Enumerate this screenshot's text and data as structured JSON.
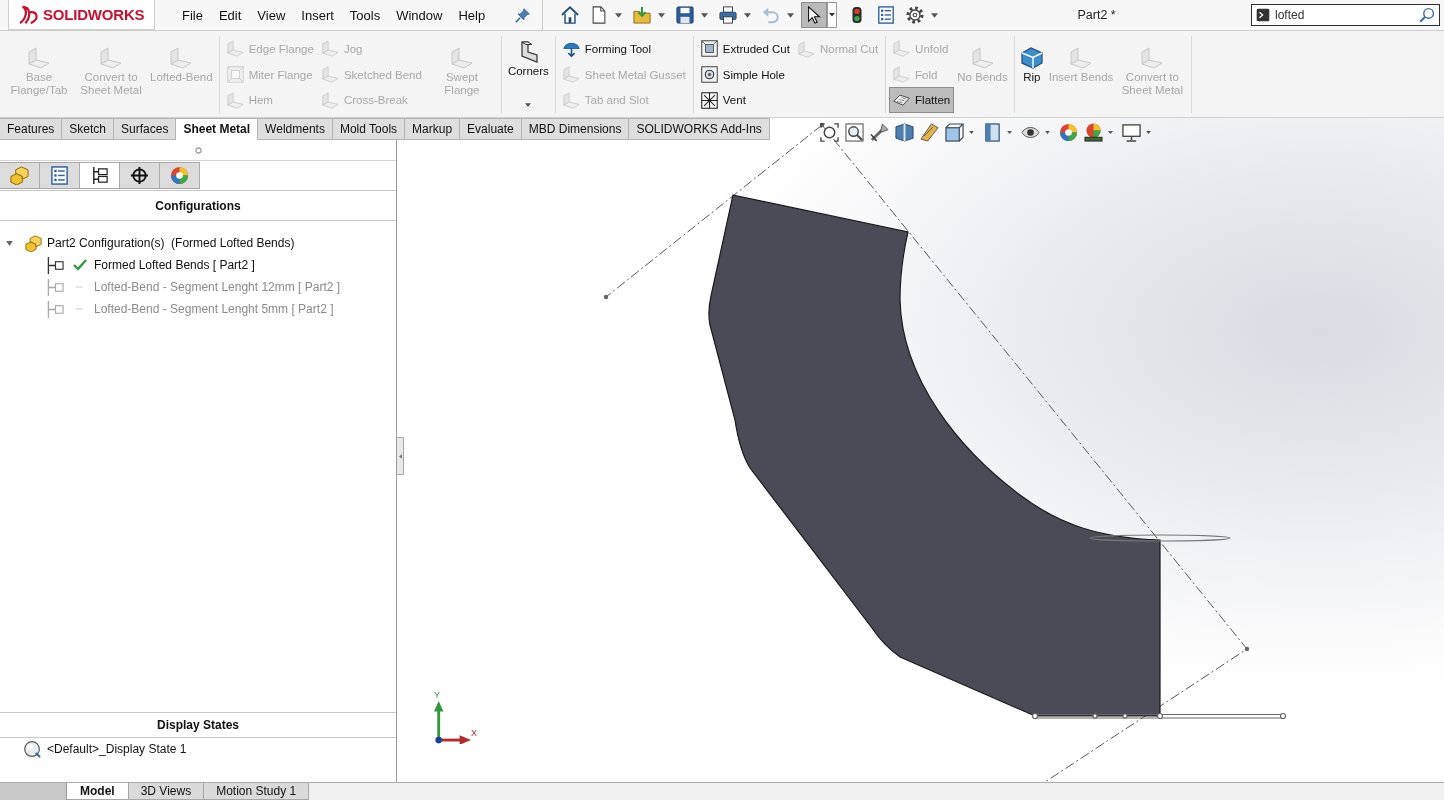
{
  "app": {
    "logo": "SOLIDWORKS"
  },
  "menu": [
    "File",
    "Edit",
    "View",
    "Insert",
    "Tools",
    "Window",
    "Help"
  ],
  "quick_access": [
    {
      "dropdown": false,
      "disabled": false,
      "pressed": false
    },
    {
      "dropdown": true,
      "disabled": false,
      "pressed": false
    },
    {
      "dropdown": true,
      "disabled": false,
      "pressed": false
    },
    {
      "dropdown": true,
      "disabled": false,
      "pressed": false
    },
    {
      "dropdown": true,
      "disabled": false,
      "pressed": false
    },
    {
      "dropdown": true,
      "disabled": true,
      "pressed": false
    },
    {
      "dropdown": true,
      "disabled": false,
      "pressed": true
    },
    {
      "dropdown": false,
      "disabled": false,
      "pressed": false
    },
    {
      "dropdown": false,
      "disabled": false,
      "pressed": false
    },
    {
      "dropdown": true,
      "disabled": false,
      "pressed": false
    }
  ],
  "window": {
    "title": "Part2 *"
  },
  "search": {
    "value": "lofted"
  },
  "ribbon": [
    [
      {
        "kind": "large",
        "label": "Base Flange/Tab",
        "disabled": true,
        "pressed": false
      },
      {
        "kind": "large",
        "label": "Convert to Sheet Metal",
        "disabled": true,
        "pressed": false
      },
      {
        "kind": "large",
        "label": "Lofted-Bend",
        "disabled": true,
        "pressed": false
      }
    ],
    [
      {
        "kind": "stack",
        "items": [
          {
            "label": "Edge Flange",
            "disabled": true,
            "pressed": false
          },
          {
            "label": "Miter Flange",
            "disabled": true,
            "pressed": false
          },
          {
            "label": "Hem",
            "disabled": true,
            "pressed": false
          }
        ]
      },
      {
        "kind": "stack",
        "items": [
          {
            "label": "Jog",
            "disabled": true,
            "pressed": false
          },
          {
            "label": "Sketched Bend",
            "disabled": true,
            "pressed": false
          },
          {
            "label": "Cross-Break",
            "disabled": true,
            "pressed": false
          }
        ]
      },
      {
        "kind": "large",
        "label": "Swept Flange",
        "disabled": true,
        "pressed": false
      }
    ],
    [
      {
        "kind": "dropdown",
        "label": "Corners",
        "disabled": false,
        "pressed": false
      }
    ],
    [
      {
        "kind": "stack",
        "items": [
          {
            "label": "Forming Tool",
            "disabled": false,
            "pressed": false
          },
          {
            "label": "Sheet Metal Gusset",
            "disabled": true,
            "pressed": false
          },
          {
            "label": "Tab and Slot",
            "disabled": true,
            "pressed": false
          }
        ]
      }
    ],
    [
      {
        "kind": "stack",
        "items": [
          {
            "label": "Extruded Cut",
            "disabled": false,
            "pressed": false
          },
          {
            "label": "Simple Hole",
            "disabled": false,
            "pressed": false
          },
          {
            "label": "Vent",
            "disabled": false,
            "pressed": false
          }
        ]
      },
      {
        "kind": "stack",
        "items": [
          {
            "label": "Normal Cut",
            "disabled": true,
            "pressed": false
          }
        ]
      }
    ],
    [
      {
        "kind": "stack",
        "items": [
          {
            "label": "Unfold",
            "disabled": true,
            "pressed": false
          },
          {
            "label": "Fold",
            "disabled": true,
            "pressed": false
          },
          {
            "label": "Flatten",
            "disabled": false,
            "pressed": true
          }
        ]
      },
      {
        "kind": "large",
        "label": "No Bends",
        "disabled": true,
        "pressed": false
      }
    ],
    [
      {
        "kind": "large",
        "label": "Rip",
        "disabled": false,
        "pressed": false
      },
      {
        "kind": "large",
        "label": "Insert Bends",
        "disabled": true,
        "pressed": false
      },
      {
        "kind": "large",
        "label": "Convert to Sheet Metal",
        "disabled": true,
        "pressed": false
      }
    ]
  ],
  "command_tabs": [
    {
      "label": "Features",
      "selected": false
    },
    {
      "label": "Sketch",
      "selected": false
    },
    {
      "label": "Surfaces",
      "selected": false
    },
    {
      "label": "Sheet Metal",
      "selected": true
    },
    {
      "label": "Weldments",
      "selected": false
    },
    {
      "label": "Mold Tools",
      "selected": false
    },
    {
      "label": "Markup",
      "selected": false
    },
    {
      "label": "Evaluate",
      "selected": false
    },
    {
      "label": "MBD Dimensions",
      "selected": false
    },
    {
      "label": "SOLIDWORKS Add-Ins",
      "selected": false
    }
  ],
  "panel_tabs": [
    {
      "selected": false
    },
    {
      "selected": false
    },
    {
      "selected": true
    },
    {
      "selected": false
    },
    {
      "selected": false
    }
  ],
  "configurations": {
    "title": "Configurations",
    "tree": [
      {
        "label": "Part2 Configuration(s)  (Formed Lofted Bends)",
        "expanded": true,
        "children": [
          {
            "label": "Formed Lofted Bends [ Part2 ]",
            "active": true
          },
          {
            "label": "Lofted-Bend - Segment Lenght 12mm [ Part2 ]",
            "active": false
          },
          {
            "label": "Lofted-Bend - Segment Lenght 5mm [ Part2 ]",
            "active": false
          }
        ]
      }
    ]
  },
  "display_states": {
    "title": "Display States",
    "items": [
      {
        "label": "<Default>_Display State 1"
      }
    ]
  },
  "viewport": {
    "triad": {
      "x": "X",
      "y": "Y"
    }
  },
  "bottom_tabs": [
    {
      "label": "Model",
      "selected": true
    },
    {
      "label": "3D Views",
      "selected": false
    },
    {
      "label": "Motion Study 1",
      "selected": false
    }
  ]
}
